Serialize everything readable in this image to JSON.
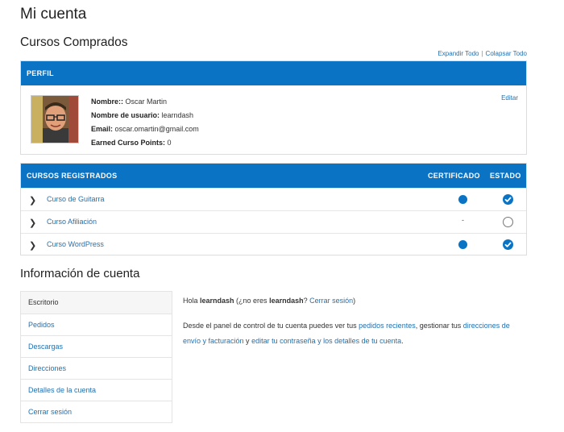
{
  "page": {
    "title": "Mi cuenta"
  },
  "courses_section": {
    "title": "Cursos Comprados",
    "expand_all": "Expandir Todo",
    "separator": "|",
    "collapse_all": "Colapsar Todo"
  },
  "profile": {
    "header": "PERFIL",
    "edit": "Editar",
    "name_label": "Nombre::",
    "name_value": "Oscar Martin",
    "username_label": "Nombre de usuario:",
    "username_value": "learndash",
    "email_label": "Email:",
    "email_value": "oscar.omartin@gmail.com",
    "points_label": "Earned Curso Points:",
    "points_value": "0"
  },
  "courses": {
    "header": "CURSOS REGISTRADOS",
    "col_certificate": "CERTIFICADO",
    "col_status": "ESTADO",
    "rows": [
      {
        "name": "Curso de Guitarra",
        "certificate": "dot",
        "status": "complete"
      },
      {
        "name": "Curso Afiliación",
        "certificate": "-",
        "status": "incomplete"
      },
      {
        "name": "Curso WordPress",
        "certificate": "dot",
        "status": "complete"
      }
    ]
  },
  "account": {
    "title": "Información de cuenta",
    "nav": [
      "Escritorio",
      "Pedidos",
      "Descargas",
      "Direcciones",
      "Detalles de la cuenta",
      "Cerrar sesión"
    ],
    "hello_1": "Hola ",
    "hello_user": "learndash",
    "hello_2": " (¿no eres ",
    "hello_user2": "learndash",
    "hello_3": "? ",
    "logout_link": "Cerrar sesión",
    "hello_4": ")",
    "desc_1": "Desde el panel de control de tu cuenta puedes ver tus ",
    "desc_link1": "pedidos recientes",
    "desc_2": ", gestionar tus ",
    "desc_link2": "direcciones de envío y facturación",
    "desc_3": " y ",
    "desc_link3": "editar tu contraseña y los detalles de tu cuenta",
    "desc_4": "."
  },
  "colors": {
    "accent": "#0a73c4",
    "link": "#2271b1"
  }
}
